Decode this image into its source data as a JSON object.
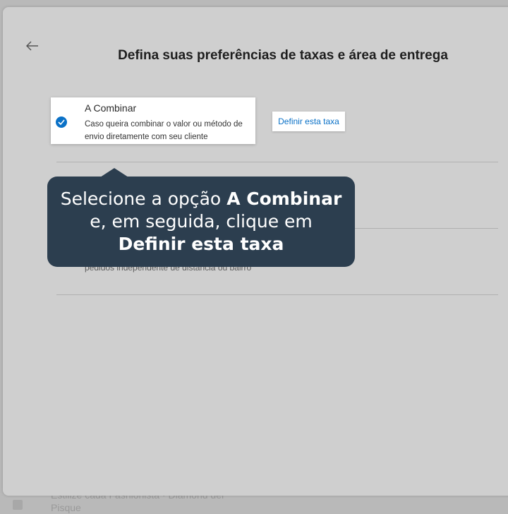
{
  "colors": {
    "accent": "#0a71c7",
    "tooltip_bg": "#2c3e4f",
    "overlay": "#cfcfcf"
  },
  "header": {
    "back_icon": "arrow-left-icon",
    "title": "Defina suas preferências de taxas e área de entrega"
  },
  "option_a_combinar": {
    "title": "A Combinar",
    "description": "Caso queira combinar o valor ou método de envio diretamente com seu cliente",
    "selected": true,
    "define_button": "Definir esta taxa"
  },
  "option_fixed": {
    "description_partial": "pedidos independente de distância ou bairro"
  },
  "tooltip": {
    "line1_prefix": "Selecione a opção ",
    "line1_bold": "A Combinar",
    "line2": "e, em seguida, clique em",
    "line3_bold": "Definir esta taxa"
  },
  "background": {
    "text_line1": "Estilize cada Fashionista · Diamond del",
    "text_line2": "Pisque"
  }
}
